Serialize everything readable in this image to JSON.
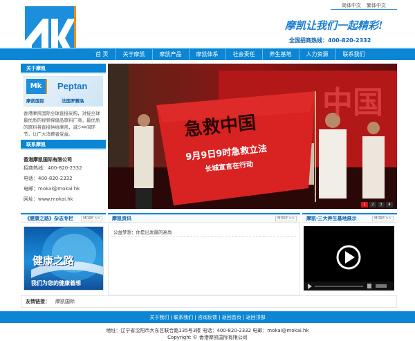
{
  "header": {
    "lang_links": [
      "简体中文",
      "繁体中文"
    ],
    "slogan": "摩凯让我们一起精彩!",
    "hotline_label": "全国招商热线：",
    "hotline_number": "400-820-2332"
  },
  "nav": [
    "首 页",
    "关于摩凯",
    "摩凯产品",
    "摩凯体系",
    "社会责任",
    "养生基地",
    "人力资源",
    "联系我们"
  ],
  "about": {
    "title": "关于摩凯",
    "logo_left_top": "Mk",
    "logo_left_bottom": "摩凯国际",
    "logo_right_top": "Peptan",
    "logo_right_bottom": "法国罗赛洛",
    "text": "香港摩凯国际全球直接采购，对接全球最优质的视频保健品原料厂商，最优质的原料将直接供给摩凯，减少中间环节，让广大消费者受益。"
  },
  "contact": {
    "title": "联系摩凯",
    "company": "香港摩凯国际有限公司",
    "lines": [
      "招商热线：400-820-2332",
      "电话：400-820-2332",
      "电邮：mokai@mokai.hk",
      "网址：www.mokai.hk"
    ]
  },
  "banner": {
    "flag_line1": "急救中国",
    "flag_line2": "9月9日9时急救立法",
    "flag_line3": "长城宣言在行动",
    "backdrop_text": "中国",
    "pager": [
      "1",
      "2",
      "3",
      "4"
    ]
  },
  "magazine": {
    "title": "《健康之路》杂志专栏",
    "more": "MORE >>",
    "cover_title": "健康之路",
    "cover_subtitle": "我们为您的健康着想"
  },
  "news": {
    "title": "摩凯资讯",
    "more": "MORE >>",
    "items": [
      "公益梦想：你是出发最的高尚"
    ]
  },
  "video": {
    "title": "摩凯·三大养生基地展示",
    "more": "MORE >>"
  },
  "friend_links": {
    "label": "友情链接：",
    "items": [
      "摩凯国际"
    ]
  },
  "footer": {
    "links": "关于我们 | 联系我们 | 咨询反馈 | 返回首页 | 返回顶部",
    "address": "地址：辽宁省沈阳市大东区联合路135号3楼  电话：400-820-2332  电邮：mokai@mokai.hk",
    "copyright": "Copyright  ©   香港摩凯国际有限公司"
  },
  "colors": {
    "brand_blue": "#0c86d4",
    "accent_orange": "#f08c1a",
    "banner_red": "#d61616"
  }
}
